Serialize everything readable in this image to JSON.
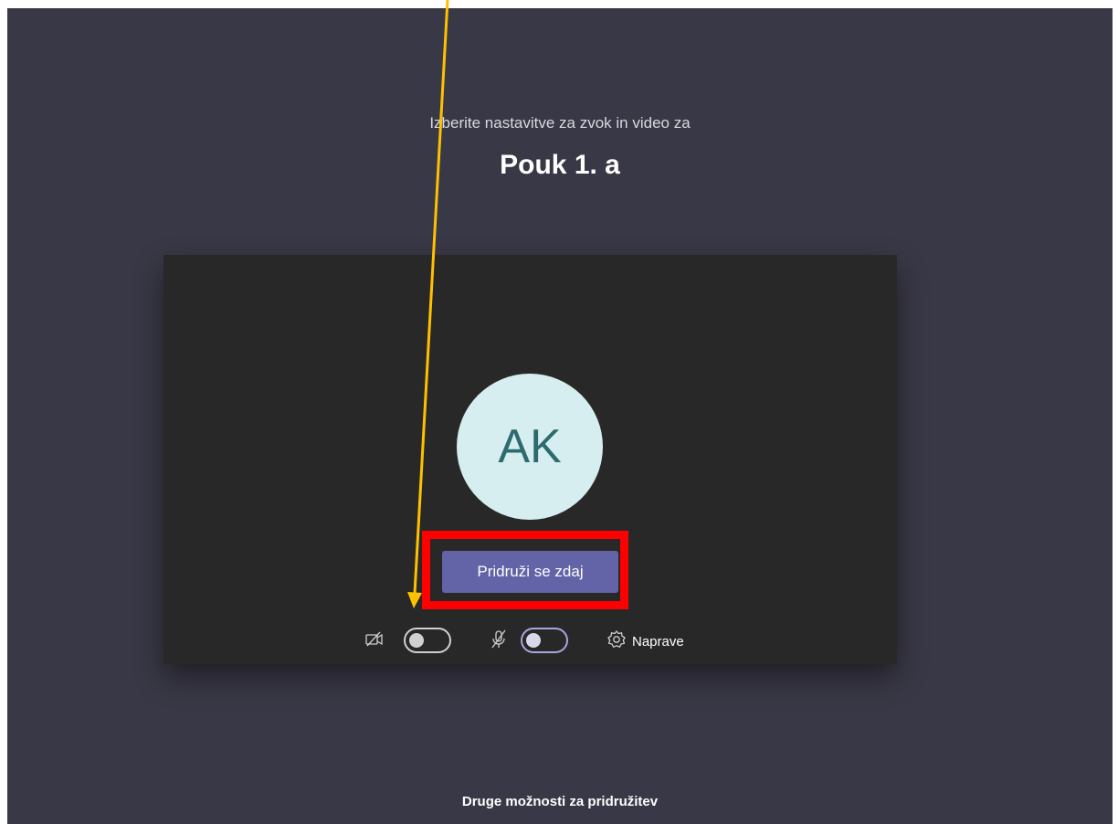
{
  "header": {
    "subtitle": "Izberite nastavitve za zvok in video za",
    "meeting_title": "Pouk 1. a"
  },
  "preview": {
    "avatar_initials": "AK",
    "join_button_label": "Pridruži se zdaj",
    "camera_toggle": {
      "icon": "camera-off-icon",
      "state": "off"
    },
    "mic_toggle": {
      "icon": "mic-off-icon",
      "state": "off"
    },
    "devices_label": "Naprave"
  },
  "footer": {
    "other_options_label": "Druge možnosti za pridružitev"
  },
  "annotations": {
    "highlight_color": "#ff0000",
    "arrow_color": "#ffc000"
  },
  "colors": {
    "stage_bg": "#393846",
    "preview_bg": "#292828",
    "accent": "#6264a7",
    "avatar_bg": "#d6eef0",
    "avatar_text": "#2e6b6e"
  }
}
